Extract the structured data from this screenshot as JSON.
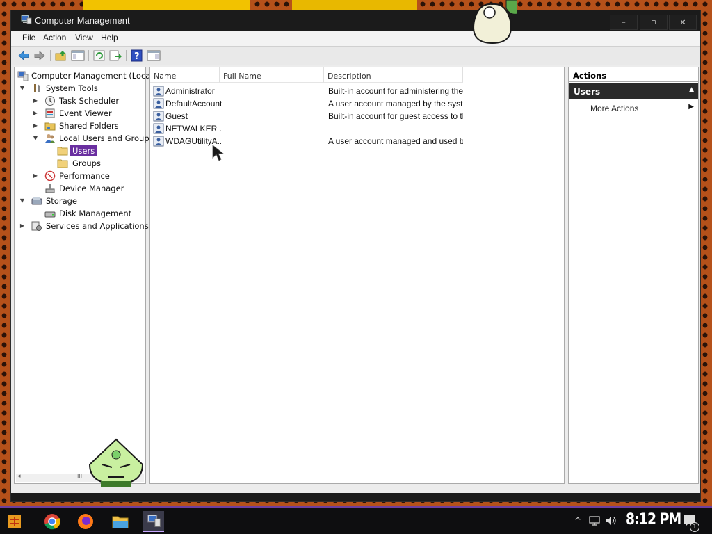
{
  "window": {
    "title": "Computer Management",
    "controls": {
      "minimize": "–",
      "maximize": "▫",
      "close": "×"
    }
  },
  "menu": [
    "File",
    "Action",
    "View",
    "Help"
  ],
  "toolbar": {
    "buttons": [
      "back-icon",
      "forward-icon",
      "up-icon",
      "show-hide-tree-icon",
      "refresh-icon",
      "export-list-icon",
      "help-icon",
      "show-hide-action-pane-icon"
    ]
  },
  "tree": {
    "root": "Computer Management (Local)",
    "system_tools": "System Tools",
    "task_scheduler": "Task Scheduler",
    "event_viewer": "Event Viewer",
    "shared_folders": "Shared Folders",
    "local_users_groups": "Local Users and Groups",
    "users": "Users",
    "groups": "Groups",
    "performance": "Performance",
    "device_manager": "Device Manager",
    "storage": "Storage",
    "disk_management": "Disk Management",
    "services_apps": "Services and Applications",
    "scroll_grip": "III"
  },
  "list": {
    "columns": [
      "Name",
      "Full Name",
      "Description"
    ],
    "rows": [
      {
        "name": "Administrator",
        "full_name": "",
        "description": "Built-in account for administering the ..."
      },
      {
        "name": "DefaultAccount",
        "full_name": "",
        "description": "A user account managed by the syst..."
      },
      {
        "name": "Guest",
        "full_name": "",
        "description": "Built-in account for guest access to th..."
      },
      {
        "name": "NETWALKER ...",
        "full_name": "",
        "description": ""
      },
      {
        "name": "WDAGUtilityA...",
        "full_name": "",
        "description": "A user account managed and used b..."
      }
    ]
  },
  "actions": {
    "header": "Actions",
    "section": "Users",
    "more_actions": "More Actions"
  },
  "taskbar": {
    "apps": [
      "start-icon",
      "chrome-icon",
      "firefox-icon",
      "file-explorer-icon",
      "computer-management-icon"
    ],
    "time": "8:12 PM",
    "notification_count": "1"
  },
  "colors": {
    "selection": "#6a2fa0",
    "titlebar": "#1b1b1b",
    "desktop": "#b5511a",
    "taskbar_accent": "#6d3fa0"
  }
}
